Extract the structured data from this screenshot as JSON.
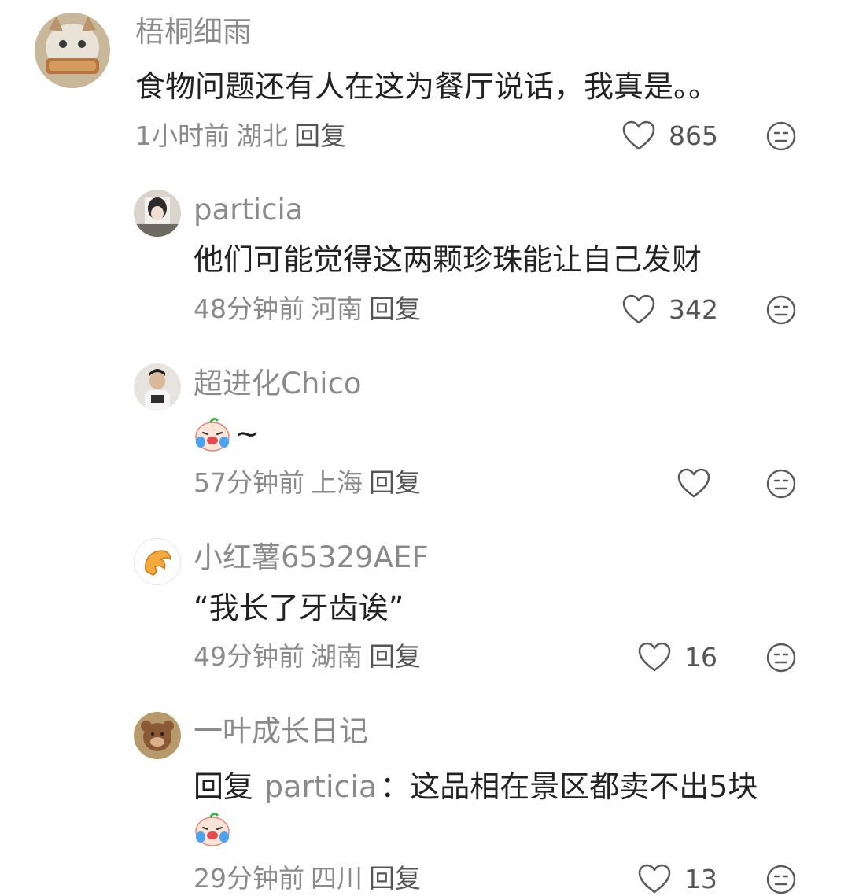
{
  "comments": [
    {
      "username": "梧桐细雨",
      "content": "食物问题还有人在这为餐厅说话，我真是。。",
      "time": "1小时前",
      "location": "湖北",
      "reply_label": "回复",
      "likes": "865"
    },
    {
      "username": "particia",
      "content": "他们可能觉得这两颗珍珠能让自己发财",
      "time": "48分钟前",
      "location": "河南",
      "reply_label": "回复",
      "likes": "342"
    },
    {
      "username": "超进化Chico",
      "content": "~",
      "emoji": "crying-laughing-emoji",
      "time": "57分钟前",
      "location": "上海",
      "reply_label": "回复",
      "likes": ""
    },
    {
      "username": "小红薯65329AEF",
      "content": "“我长了牙齿诶”",
      "time": "49分钟前",
      "location": "湖南",
      "reply_label": "回复",
      "likes": "16"
    },
    {
      "username": "一叶成长日记",
      "reply_prefix": "回复",
      "reply_to": "particia",
      "content": "：这品相在景区都卖不出5块",
      "emoji": "crying-laughing-emoji",
      "time": "29分钟前",
      "location": "四川",
      "reply_label": "回复",
      "likes": "13"
    }
  ],
  "icons": {
    "like": "heart-outline-icon",
    "dislike": "unamused-face-icon"
  },
  "colors": {
    "text": "#222222",
    "secondary": "#8a8a8a"
  }
}
